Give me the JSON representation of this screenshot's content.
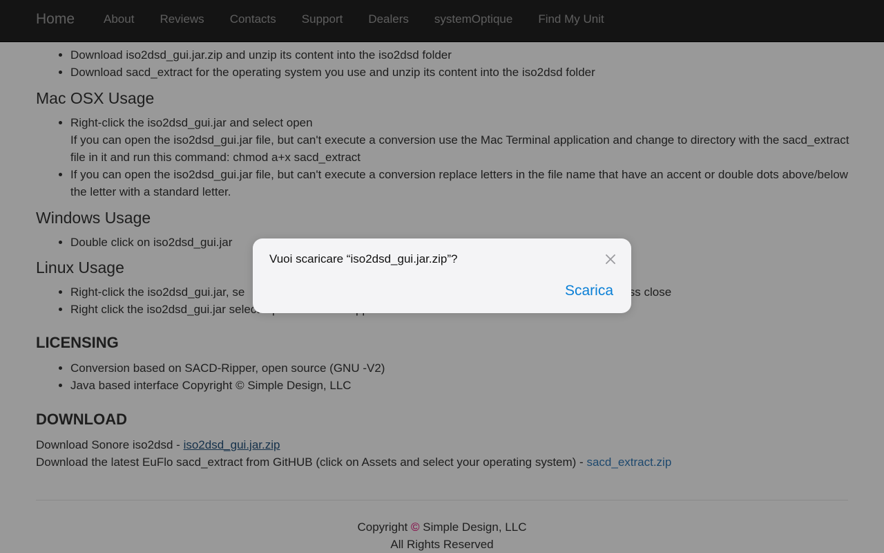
{
  "navbar": {
    "brand": "Home",
    "items": [
      "About",
      "Reviews",
      "Contacts",
      "Support",
      "Dealers",
      "systemOptique",
      "Find My Unit"
    ]
  },
  "install_steps": [
    "Download iso2dsd_gui.jar.zip and unzip its content into the iso2dsd folder",
    "Download sacd_extract for the operating system you use and unzip its content into the iso2dsd folder"
  ],
  "mac": {
    "heading": "Mac OSX Usage",
    "item1_line1": "Right-click the iso2dsd_gui.jar and select open",
    "item1_line2": "If you can open the iso2dsd_gui.jar file, but can't execute a conversion use the Mac Terminal application and change to directory with the sacd_extract file in it and run this command: chmod a+x sacd_extract",
    "item2": "If you can open the iso2dsd_gui.jar file, but can't execute a conversion replace letters in the file name that have an accent or double dots above/below the letter with a standard letter."
  },
  "windows": {
    "heading": "Windows Usage",
    "item1": "Double click on iso2dsd_gui.jar"
  },
  "linux": {
    "heading": "Linux Usage",
    "item1_start": "Right-click the iso2dsd_gui.jar, se",
    "item1_end": "ess close",
    "item2": "Right click the iso2dsd_gui.jar select Open with other application and select Java"
  },
  "licensing": {
    "heading": "LICENSING",
    "items": [
      "Conversion based on SACD-Ripper, open source (GNU -V2)",
      "Java based interface Copyright © Simple Design, LLC"
    ]
  },
  "download": {
    "heading": "DOWNLOAD",
    "line1_text": "Download Sonore iso2dsd - ",
    "line1_link": "iso2dsd_gui.jar.zip",
    "line2_text": "Download the latest EuFlo sacd_extract from GitHUB (click on Assets and select your operating system) - ",
    "line2_link": "sacd_extract.zip"
  },
  "footer": {
    "copyright_prefix": "Copyright ",
    "copyright_symbol": "©",
    "copyright_suffix": " Simple Design, LLC",
    "rights": "All Rights Reserved"
  },
  "dialog": {
    "message": "Vuoi scaricare “iso2dsd_gui.jar.zip”?",
    "action": "Scarica",
    "close_icon": "close-icon"
  },
  "colors": {
    "navbar_bg": "#222222",
    "link": "#337ab7",
    "dialog_action": "#0a7fd6",
    "copyright_symbol": "#e0006f"
  }
}
